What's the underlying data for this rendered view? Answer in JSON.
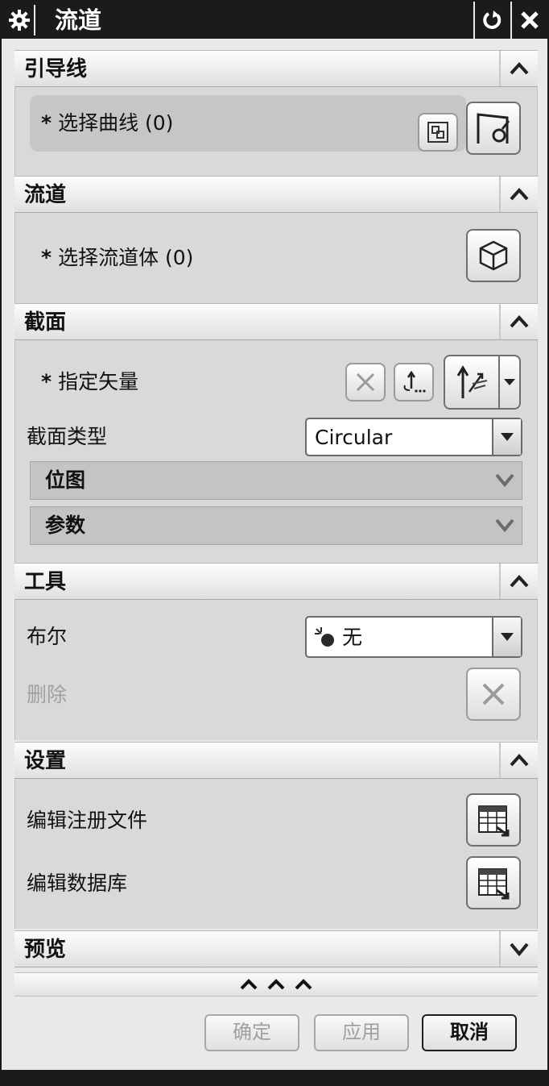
{
  "dialog": {
    "title": "流道"
  },
  "sections": {
    "guide_line": {
      "title": "引导线",
      "select_label": "选择曲线 (0)"
    },
    "runner": {
      "title": "流道",
      "select_label": "选择流道体 (0)"
    },
    "section": {
      "title": "截面",
      "vector_label": "指定矢量",
      "type_label": "截面类型",
      "type_value": "Circular",
      "subpanels": [
        "位图",
        "参数"
      ]
    },
    "tools": {
      "title": "工具",
      "boolean_label": "布尔",
      "boolean_value": "无",
      "delete_label": "删除"
    },
    "settings": {
      "title": "设置",
      "edit_registry_label": "编辑注册文件",
      "edit_database_label": "编辑数据库"
    },
    "preview": {
      "title": "预览"
    }
  },
  "footer": {
    "ok_label": "确定",
    "apply_label": "应用",
    "cancel_label": "取消"
  },
  "icons": {
    "gear": "gear-icon",
    "reset": "reset-icon",
    "close": "close-icon",
    "collapse": "chevron-up-icon",
    "expand": "chevron-down-icon",
    "curve_rule": "curve-rule-icon",
    "curve_select": "curve-select-icon",
    "solid_body": "solid-body-icon",
    "reverse_direction": "reverse-direction-icon",
    "vector_dialog": "vector-dialog-icon",
    "inferred_vector": "inferred-vector-icon",
    "boolean_none": "boolean-none-icon",
    "delete": "delete-icon",
    "table_edit": "table-edit-icon"
  }
}
